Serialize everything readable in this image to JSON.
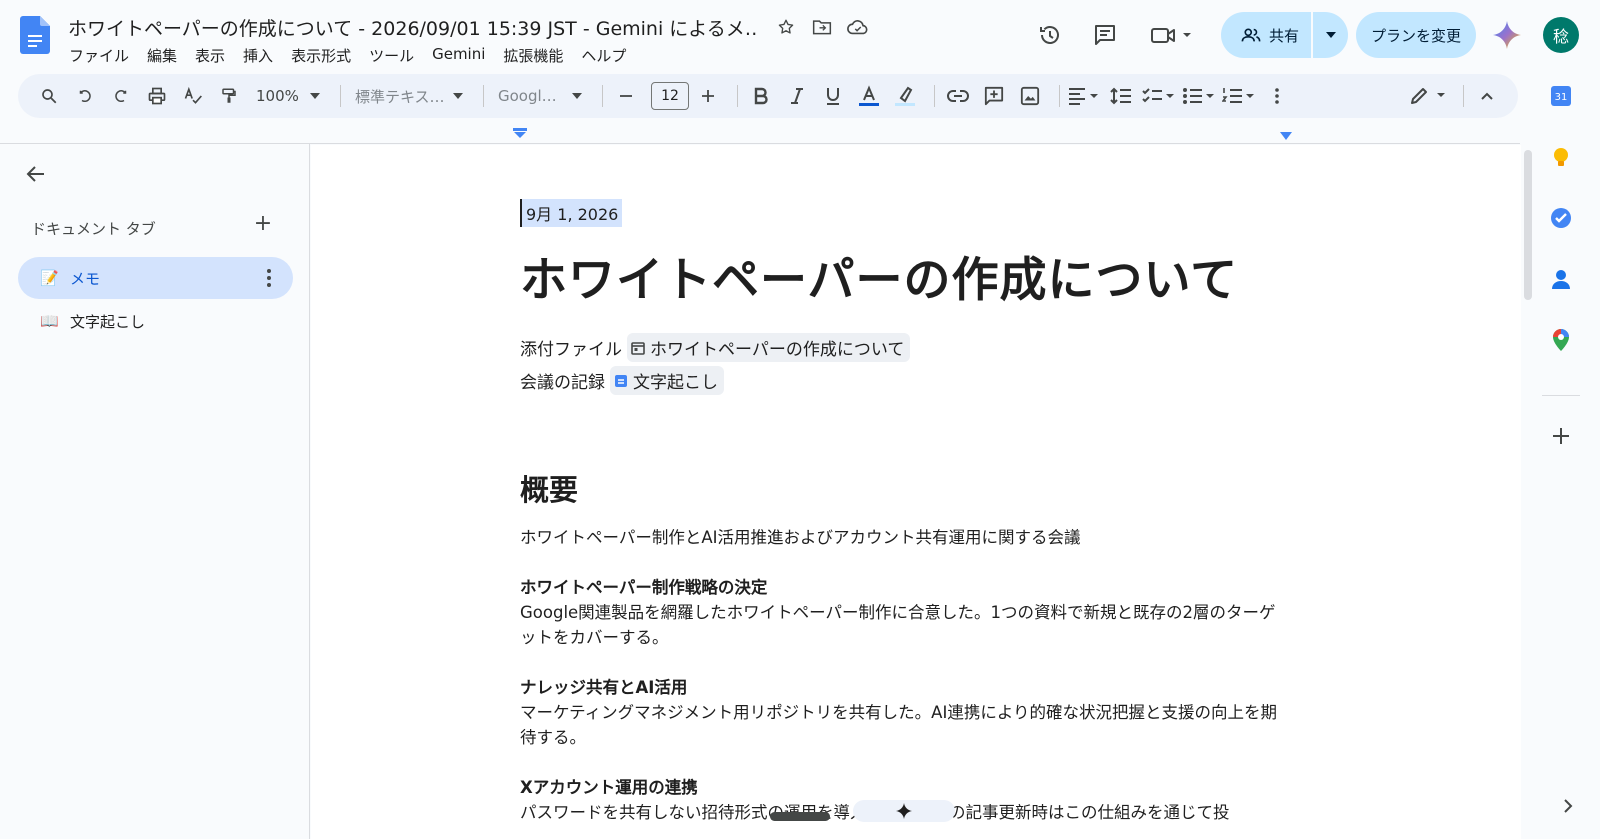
{
  "app": {
    "title": "ホワイトペーパーの作成について - 2026/09/01 15:39 JST - Gemini によるメ…"
  },
  "menu": [
    "ファイル",
    "編集",
    "表示",
    "挿入",
    "表示形式",
    "ツール",
    "Gemini",
    "拡張機能",
    "ヘルプ"
  ],
  "header": {
    "share_label": "共有",
    "plan_label": "プランを変更",
    "avatar_initial": "稔"
  },
  "toolbar": {
    "zoom": "100%",
    "style": "標準テキス…",
    "font": "Googl…",
    "font_size": "12"
  },
  "sidebar": {
    "heading": "ドキュメント タブ",
    "tabs": [
      {
        "emoji": "📝",
        "label": "メモ",
        "active": true
      },
      {
        "emoji": "📖",
        "label": "文字起こし",
        "active": false
      }
    ]
  },
  "document": {
    "date": "9月 1, 2026",
    "title": "ホワイトペーパーの作成について",
    "attachment_label": "添付ファイル",
    "attachment_chip": "ホワイトペーパーの作成について",
    "record_label": "会議の記録",
    "record_chip": "文字起こし",
    "summary_heading": "概要",
    "summary_text": "ホワイトペーパー制作とAI活用推進およびアカウント共有運用に関する会議",
    "sections": [
      {
        "heading": "ホワイトペーパー制作戦略の決定",
        "body": "Google関連製品を網羅したホワイトペーパー制作に合意した。1つの資料で新規と既存の2層のターゲットをカバーする。"
      },
      {
        "heading": "ナレッジ共有とAI活用",
        "body": "マーケティングマネジメント用リポジトリを共有した。AI連携により的確な状況把握と支援の向上を期待する。"
      },
      {
        "heading": "Xアカウント運用の連携",
        "body": "パスワードを共有しない招待形式の運用を導入した。今後の記事更新時はこの仕組みを通じて投"
      }
    ]
  },
  "colors": {
    "accent": "#0b57d0",
    "share_bg": "#c2e7ff",
    "active_tab_bg": "#d3e3fd",
    "toolbar_bg": "#edf2fa"
  }
}
